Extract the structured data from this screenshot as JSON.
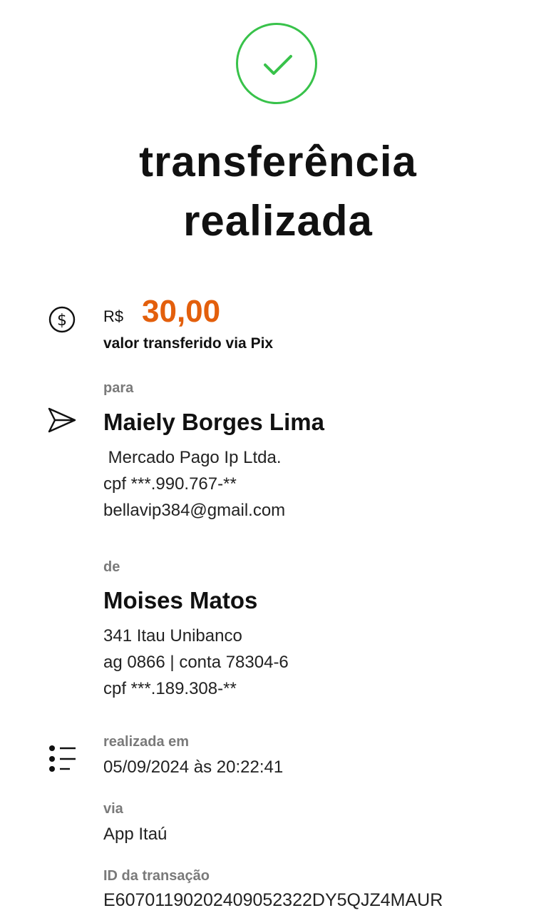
{
  "header": {
    "status_icon": "check-circle-icon",
    "title_line1": "transferência",
    "title_line2": "realizada"
  },
  "amount": {
    "icon": "dollar-circle-icon",
    "currency": "R$",
    "value": "30,00",
    "caption": "valor transferido via Pix",
    "color": "#e35f0c"
  },
  "recipient": {
    "icon": "send-icon",
    "label": "para",
    "name": "Maiely Borges Lima",
    "institution": " Mercado Pago Ip Ltda.",
    "cpf": "cpf ***.990.767-**",
    "pix_key": "bellavip384@gmail.com"
  },
  "sender": {
    "label": "de",
    "name": "Moises Matos",
    "bank": "341 Itau Unibanco",
    "account": "ag 0866 | conta 78304-6",
    "cpf": "cpf ***.189.308-**"
  },
  "details": {
    "icon": "list-icon",
    "date_label": "realizada em",
    "date_value": "05/09/2024 às 20:22:41",
    "via_label": "via",
    "via_value": "App Itaú",
    "id_label": "ID da transação",
    "id_value": "E60701190202409052322DY5QJZ4MAUR"
  },
  "colors": {
    "success": "#38c24a",
    "amount": "#e35f0c",
    "label": "#7a7a7a"
  }
}
